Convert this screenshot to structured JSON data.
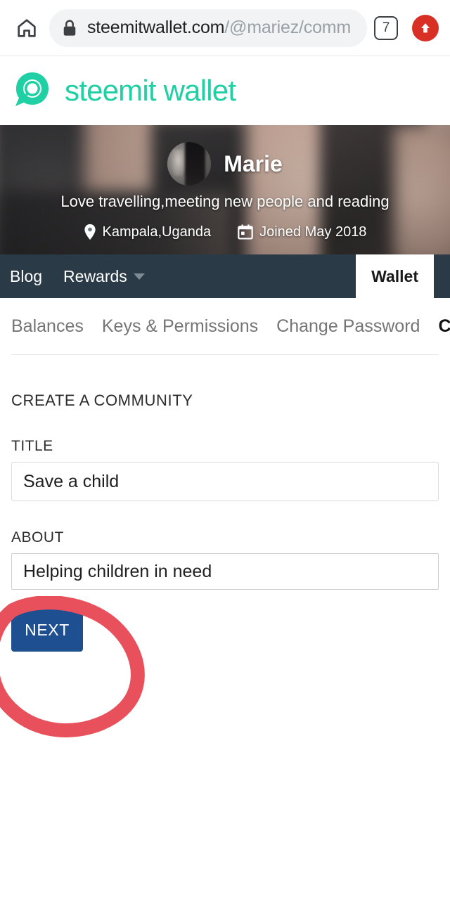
{
  "browser": {
    "home_icon": "home-icon",
    "lock_icon": "lock-icon",
    "url_domain": "steemitwallet.com",
    "url_path": "/@mariez/comm",
    "tab_count": "7",
    "update_icon": "upload-arrow-icon"
  },
  "site": {
    "logo_icon": "steemit-logo-icon",
    "logo_text": "steemit wallet",
    "brand_color": "#1ed0a3"
  },
  "profile": {
    "avatar_icon": "user-avatar",
    "display_name": "Marie",
    "bio": "Love travelling,meeting new people and reading",
    "location_icon": "map-pin-icon",
    "location": "Kampala,Uganda",
    "joined_icon": "calendar-icon",
    "joined": "Joined May 2018"
  },
  "nav": {
    "background": "#2b3a47",
    "items": [
      {
        "label": "Blog",
        "has_caret": false
      },
      {
        "label": "Rewards",
        "has_caret": true
      }
    ],
    "caret_icon": "chevron-down-icon",
    "active_tab": "Wallet"
  },
  "subtabs": [
    {
      "label": "Balances",
      "active": false
    },
    {
      "label": "Keys & Permissions",
      "active": false
    },
    {
      "label": "Change Password",
      "active": false
    },
    {
      "label": "Communities",
      "active": true
    }
  ],
  "form": {
    "section_title": "CREATE A COMMUNITY",
    "title_label": "TITLE",
    "title_value": "Save a child",
    "title_placeholder": "",
    "about_label": "ABOUT",
    "about_value": "Helping children in need",
    "about_placeholder": "",
    "next_label": "NEXT",
    "next_color": "#1d4f91"
  },
  "annotation": {
    "shape": "hand-drawn-circle",
    "color": "#e8505b",
    "targets": "next-button"
  }
}
